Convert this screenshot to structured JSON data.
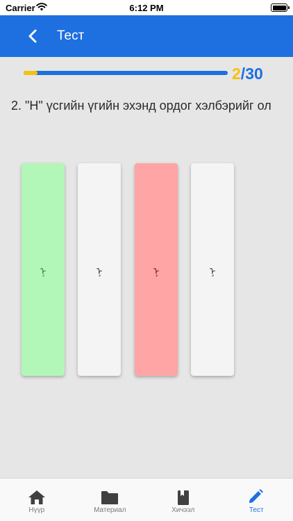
{
  "status_bar": {
    "carrier": "Carrier",
    "time": "6:12 PM"
  },
  "header": {
    "title": "Тест"
  },
  "progress": {
    "current": "2",
    "separator": "/",
    "total": "30",
    "fraction": 0.067
  },
  "question": {
    "text": "2. \"Н\" үсгийн үгийн эхэнд ордог хэлбэрийг ол"
  },
  "options": [
    {
      "glyph": "ᠨ",
      "state": "correct",
      "color": "#b2f7b8"
    },
    {
      "glyph": "ᠨ",
      "state": "neutral",
      "color": "#f4f4f4"
    },
    {
      "glyph": "ᠨ",
      "state": "wrong",
      "color": "#ffa5a5"
    },
    {
      "glyph": "ᠨ",
      "state": "neutral",
      "color": "#f4f4f4"
    }
  ],
  "tabs": [
    {
      "label": "Нүүр",
      "icon": "home-icon",
      "active": false
    },
    {
      "label": "Материал",
      "icon": "folder-icon",
      "active": false
    },
    {
      "label": "Хичээл",
      "icon": "book-icon",
      "active": false
    },
    {
      "label": "Тест",
      "icon": "pencil-icon",
      "active": true
    }
  ],
  "colors": {
    "primary": "#1e6fdf",
    "accent": "#f4c20d",
    "correct": "#b2f7b8",
    "wrong": "#ffa5a5"
  }
}
